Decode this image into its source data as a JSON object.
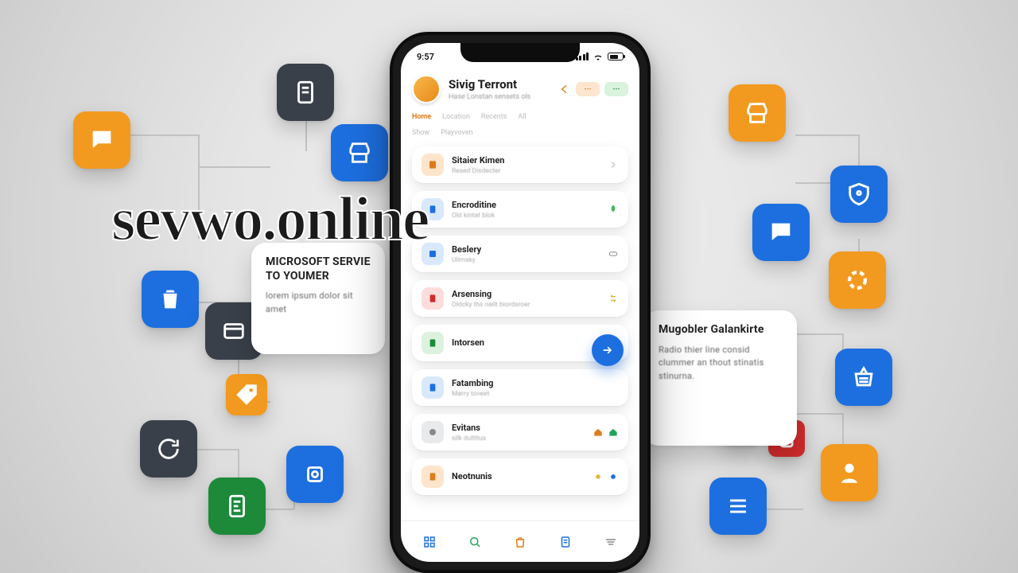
{
  "watermark": "sevwo.online",
  "colors": {
    "orange": "#f29a1f",
    "blue": "#1d6fe0",
    "slate": "#3a4049",
    "green": "#1d8a3a",
    "red": "#cf2b2b"
  },
  "card_a": {
    "title": "MICROSOFT\nSERVIE TO YOUMER",
    "body": "lorem ipsum dolor sit amet"
  },
  "card_b": {
    "title": "Mugobler Galankirte",
    "body": "Radio thier line consid clummer an thout stinatis stinurna."
  },
  "phone": {
    "status": {
      "time": "9:57"
    },
    "header": {
      "title": "Sivig Terront",
      "subtitle": "Hase   Lonstan sensets  ols"
    },
    "tabs": [
      "Home",
      "Location",
      "Recents",
      "All"
    ],
    "subtabs": [
      "Show",
      "Playvoven"
    ],
    "items": [
      {
        "icon": "or",
        "title": "Sitaier Kimen",
        "sub": "Resed Disdecter"
      },
      {
        "icon": "bl",
        "title": "Encroditine",
        "sub": "Old kintat blok"
      },
      {
        "icon": "bl",
        "title": "Beslery",
        "sub": "Ulimsky"
      },
      {
        "icon": "rd",
        "title": "Arsensing",
        "sub": "Oldcky ths nalit biordsroer"
      },
      {
        "icon": "gn",
        "title": "Intorsen",
        "sub": ""
      },
      {
        "icon": "bl",
        "title": "Fatambing",
        "sub": "Marry toveet"
      },
      {
        "icon": "gy",
        "title": "Evitans",
        "sub": "silk dultltus"
      },
      {
        "icon": "or",
        "title": "Neotnunis",
        "sub": ""
      }
    ]
  }
}
